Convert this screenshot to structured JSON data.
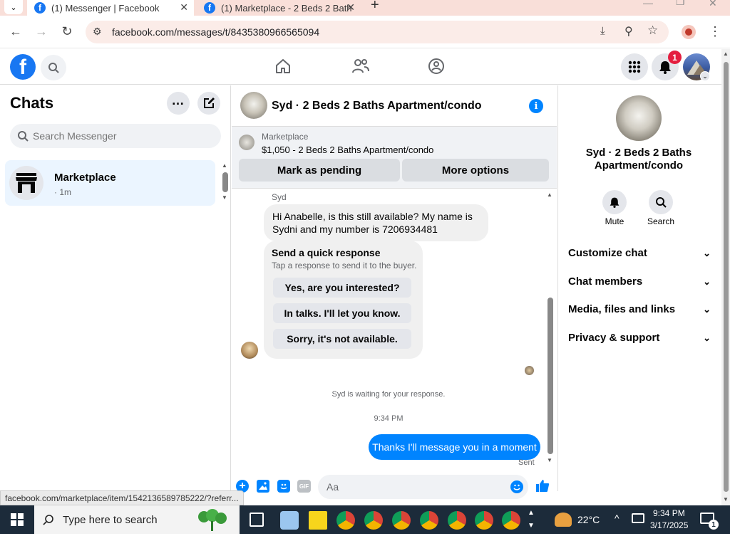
{
  "browser": {
    "tabs": [
      {
        "title": "(1) Messenger | Facebook",
        "active": true
      },
      {
        "title": "(1) Marketplace - 2 Beds 2 Bath",
        "active": false
      }
    ],
    "url": "facebook.com/messages/t/8435380966565094"
  },
  "header": {
    "notification_count": "1"
  },
  "left": {
    "title": "Chats",
    "search_placeholder": "Search Messenger",
    "chat": {
      "name": "Marketplace",
      "meta": "· 1m"
    }
  },
  "conversation": {
    "title": "Syd · 2 Beds 2 Baths Apartment/condo",
    "marketplace_label": "Marketplace",
    "listing": "$1,050 - 2 Beds 2 Baths Apartment/condo",
    "mark_pending": "Mark as pending",
    "more_options": "More options",
    "sender_name": "Syd",
    "incoming_message": "Hi Anabelle, is this still available? My name is Sydni and my number is 7206934481",
    "quick_response": {
      "title": "Send a quick response",
      "subtitle": "Tap a response to send it to the buyer.",
      "options": [
        "Yes, are you interested?",
        "In talks. I'll let you know.",
        "Sorry, it's not available."
      ]
    },
    "waiting_text": "Syd is waiting for your response.",
    "timestamp": "9:34 PM",
    "outgoing_message": "Thanks I'll message you in a moment",
    "sent_label": "Sent",
    "composer_placeholder": "Aa"
  },
  "right": {
    "name": "Syd · 2 Beds 2 Baths Apartment/condo",
    "mute_label": "Mute",
    "search_label": "Search",
    "sections": [
      "Customize chat",
      "Chat members",
      "Media, files and links",
      "Privacy & support"
    ]
  },
  "status_link": "facebook.com/marketplace/item/1542136589785222/?referr...",
  "taskbar": {
    "search_placeholder": "Type here to search",
    "temperature": "22°C",
    "time": "9:34 PM",
    "date": "3/17/2025",
    "notif_count": "1"
  },
  "colors": {
    "accent": "#0084ff",
    "brand": "#1877f2",
    "badge": "#e41e3f"
  }
}
